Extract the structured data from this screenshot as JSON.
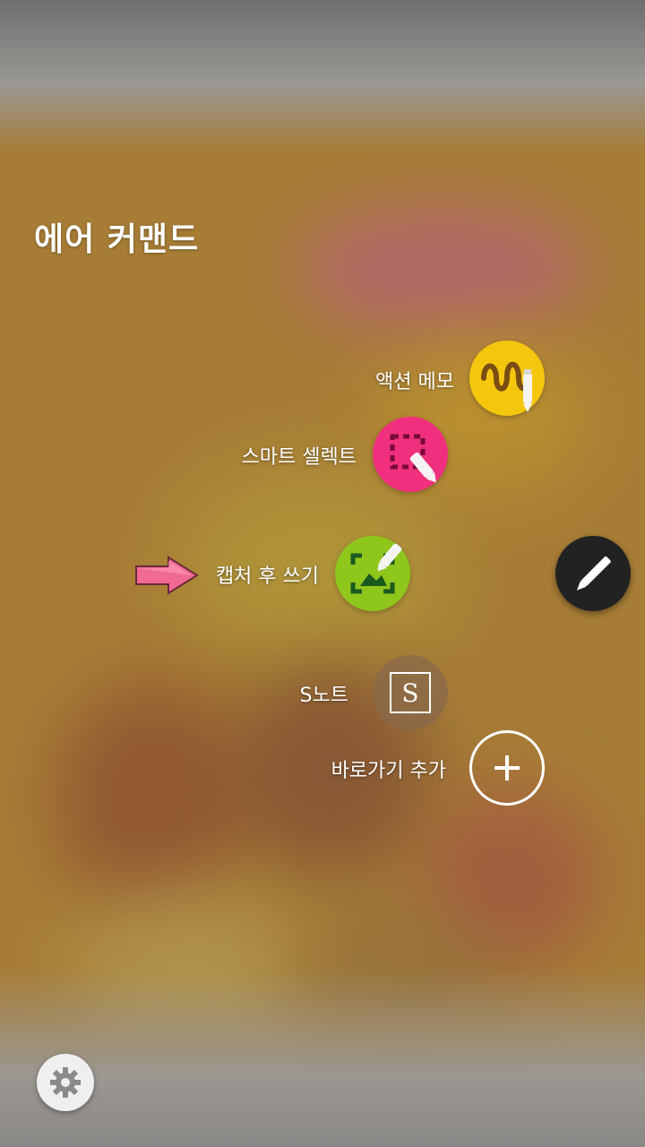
{
  "title": "에어 커맨드",
  "items": [
    {
      "label": "액션 메모",
      "icon": "squiggle-pen-icon",
      "color": "#f5c60e"
    },
    {
      "label": "스마트 셀렉트",
      "icon": "dashed-select-pen-icon",
      "color": "#f0307e"
    },
    {
      "label": "캡처 후 쓰기",
      "icon": "capture-write-icon",
      "color": "#8fc61b"
    },
    {
      "label": "S노트",
      "icon": "s-note-icon",
      "color": "#8a6a49"
    },
    {
      "label": "바로가기 추가",
      "icon": "plus-icon",
      "color": "#ffffff"
    }
  ],
  "fab": {
    "icon": "pen-icon",
    "color": "#222222"
  },
  "settings": {
    "icon": "gear-icon"
  },
  "snote_letter": "S",
  "annotation": {
    "icon": "pink-arrow-icon",
    "color": "#f06a91"
  }
}
